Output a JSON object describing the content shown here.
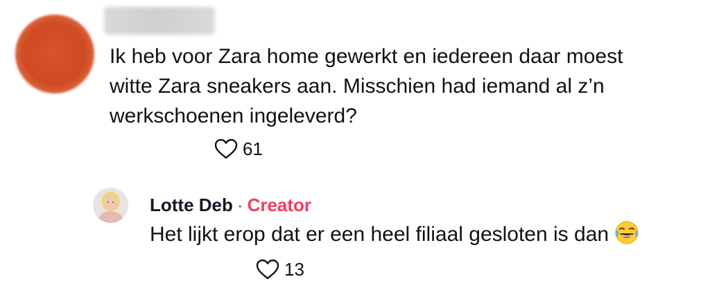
{
  "main_comment": {
    "avatar_icon": "blurred-avatar",
    "author_name": "",
    "lines": [
      "Ik heb voor Zara home gewerkt en iedereen daar moest",
      "witte Zara sneakers aan. Misschien had iemand al z’n",
      "werkschoenen ingeleverd?"
    ],
    "like_icon": "heart-outline-icon",
    "likes": "61"
  },
  "reply": {
    "author": "Lotte Deb",
    "separator": "·",
    "badge": "Creator",
    "text": "Het lijkt erop dat er een heel filiaal gesloten is dan",
    "emoji_icon": "face-with-tears-of-joy-icon",
    "like_icon": "heart-outline-icon",
    "likes": "13"
  },
  "colors": {
    "creator_badge": "#f23c5c",
    "text": "#111111",
    "avatar_main": "#cf4a22"
  }
}
